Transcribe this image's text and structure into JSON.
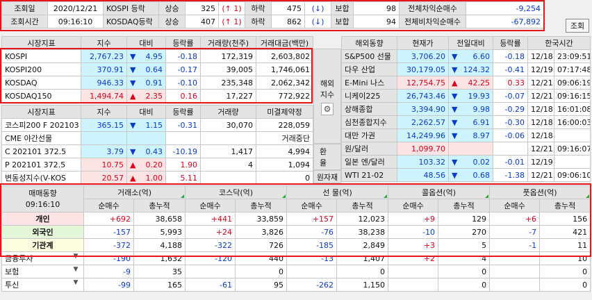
{
  "top": {
    "date_label": "조회일",
    "date_value": "2020/12/21",
    "time_label": "조회시간",
    "time_value": "09:16:10",
    "kospi_label": "KOSPI 등락",
    "kosdaq_label": "KOSDAQ등락",
    "rise_label": "상승",
    "fall_label": "하락",
    "flat_label": "보합",
    "kospi": {
      "rise": "325",
      "rise_limit": "1",
      "fall": "475",
      "flat": "98"
    },
    "kosdaq": {
      "rise": "407",
      "rise_limit": "1",
      "fall": "862",
      "flat": "94"
    },
    "total_arb_label": "전체차익순매수",
    "total_arb": "-9,254",
    "total_nonarb_label": "전체비차익순매수",
    "total_nonarb": "-67,892",
    "query_button": "조회"
  },
  "index_table": {
    "headers": [
      "시장지표",
      "지수",
      "대비",
      "등락률",
      "거래량(천주)",
      "거래대금(백만)"
    ],
    "rows": [
      {
        "name": "KOSPI",
        "value": "2,767.23",
        "arrow": "▼",
        "change": "4.95",
        "rate": "-0.18",
        "volume": "172,319",
        "amount": "2,603,802"
      },
      {
        "name": "KOSPI200",
        "value": "370.91",
        "arrow": "▼",
        "change": "0.64",
        "rate": "-0.17",
        "volume": "39,005",
        "amount": "1,746,061"
      },
      {
        "name": "KOSDAQ",
        "value": "946.33",
        "arrow": "▼",
        "change": "0.91",
        "rate": "-0.10",
        "volume": "235,348",
        "amount": "2,062,342"
      },
      {
        "name": "KOSDAQ150",
        "value": "1,494.74",
        "arrow": "▲",
        "change": "2.35",
        "rate": "0.16",
        "volume": "17,227",
        "amount": "772,922"
      }
    ]
  },
  "futures_table": {
    "headers": [
      "시장지표",
      "지수",
      "대비",
      "등락률",
      "거래량",
      "미결제약정"
    ],
    "rows": [
      {
        "name": "코스피200 F 202103",
        "value": "365.15",
        "arrow": "▼",
        "change": "1.15",
        "rate": "-0.31",
        "volume": "30,070",
        "oi": "228,059"
      },
      {
        "name": "CME 야간선물",
        "value": "",
        "arrow": "",
        "change": "",
        "rate": "",
        "volume": "",
        "oi": "거래중단"
      },
      {
        "name": "C 202101 372.5",
        "value": "3.79",
        "arrow": "▼",
        "change": "0.43",
        "rate": "-10.19",
        "volume": "1,417",
        "oi": "4,994"
      },
      {
        "name": "P 202101 372.5",
        "value": "10.75",
        "arrow": "▲",
        "change": "0.20",
        "rate": "1.90",
        "volume": "4",
        "oi": "1,094"
      },
      {
        "name": "변동성지수(V-KOS",
        "value": "20.57",
        "arrow": "▲",
        "change": "1.00",
        "rate": "5.11",
        "volume": "",
        "oi": "0"
      }
    ]
  },
  "side": {
    "overseas_line1": "해외",
    "overseas_line2": "지수",
    "fx_line1": "환",
    "fx_line2": "율",
    "commodity": "원자재"
  },
  "world_table": {
    "headers": [
      "해외동향",
      "현재가",
      "전일대비",
      "등락률",
      "한국시간"
    ],
    "rows": [
      {
        "name": "S&P500 선물",
        "price": "3,706.20",
        "arrow": "▼",
        "change": "6.60",
        "rate": "-0.18",
        "date": "12/18",
        "time": "23:09:51"
      },
      {
        "name": "다우 산업",
        "price": "30,179.05",
        "arrow": "▼",
        "change": "124.32",
        "rate": "-0.41",
        "date": "12/19",
        "time": "07:17:48"
      },
      {
        "name": "E-Mini 나스",
        "price": "12,754.75",
        "arrow": "▲",
        "change": "42.25",
        "rate": "0.33",
        "date": "12/21",
        "time": "09:06:19"
      },
      {
        "name": "니케이225",
        "price": "26,743.46",
        "arrow": "▼",
        "change": "19.93",
        "rate": "-0.07",
        "date": "12/21",
        "time": "09:16:15"
      },
      {
        "name": "상해종합",
        "price": "3,394.90",
        "arrow": "▼",
        "change": "9.98",
        "rate": "-0.29",
        "date": "12/18",
        "time": "16:01:08"
      },
      {
        "name": "심천종합지수",
        "price": "2,262.57",
        "arrow": "▼",
        "change": "6.91",
        "rate": "-0.30",
        "date": "12/18",
        "time": "16:00:03"
      },
      {
        "name": "대만 가권",
        "price": "14,249.96",
        "arrow": "▼",
        "change": "8.97",
        "rate": "-0.06",
        "date": "12/18",
        "time": ""
      },
      {
        "name": "원/달러",
        "price": "1,099.70",
        "arrow": "",
        "change": "",
        "rate": "",
        "date": "12/21",
        "time": "09:16:07"
      },
      {
        "name": "일본 엔/달러",
        "price": "103.32",
        "arrow": "▼",
        "change": "0.02",
        "rate": "-0.01",
        "date": "12/19",
        "time": ""
      },
      {
        "name": "WTI 21-02",
        "price": "48.56",
        "arrow": "▼",
        "change": "0.68",
        "rate": "-1.38",
        "date": "12/21",
        "time": "09:06:10"
      }
    ]
  },
  "trend_table": {
    "title": "매매동향",
    "time": "09:16:10",
    "groups": [
      "거래소(억)",
      "코스닥(억)",
      "선 물(억)",
      "콜옵션(억)",
      "풋옵션(억)"
    ],
    "sub_net": "순매수",
    "sub_total": "총누적",
    "main_rows": [
      {
        "name": "개인",
        "cells": [
          "+692",
          "38,658",
          "+441",
          "33,859",
          "+157",
          "12,023",
          "+9",
          "129",
          "+6",
          "156"
        ]
      },
      {
        "name": "외국인",
        "cells": [
          "-157",
          "5,993",
          "+24",
          "3,826",
          "-76",
          "38,238",
          "-10",
          "270",
          "-7",
          "421"
        ]
      },
      {
        "name": "기관계",
        "cells": [
          "-372",
          "4,188",
          "-322",
          "726",
          "-185",
          "2,849",
          "+3",
          "5",
          "-1",
          "11"
        ]
      }
    ],
    "sub_rows": [
      {
        "name": "금융투자",
        "cells": [
          "-190",
          "1,632",
          "-120",
          "440",
          "-13",
          "1,407",
          "+2",
          "4",
          "",
          "10"
        ]
      },
      {
        "name": "보험",
        "cells": [
          "-9",
          "35",
          "",
          "0",
          "",
          "0",
          "",
          "0",
          "",
          "0"
        ]
      },
      {
        "name": "투신",
        "cells": [
          "-99",
          "165",
          "-61",
          "95",
          "-262",
          "1,150",
          "",
          "0",
          "",
          "0"
        ]
      }
    ]
  },
  "colors": {
    "up": "#e0001a",
    "down": "#0a3ccc",
    "highlight_box": "#e8141c",
    "cyan": "#cdf4fc",
    "pink": "#fde4e4"
  }
}
